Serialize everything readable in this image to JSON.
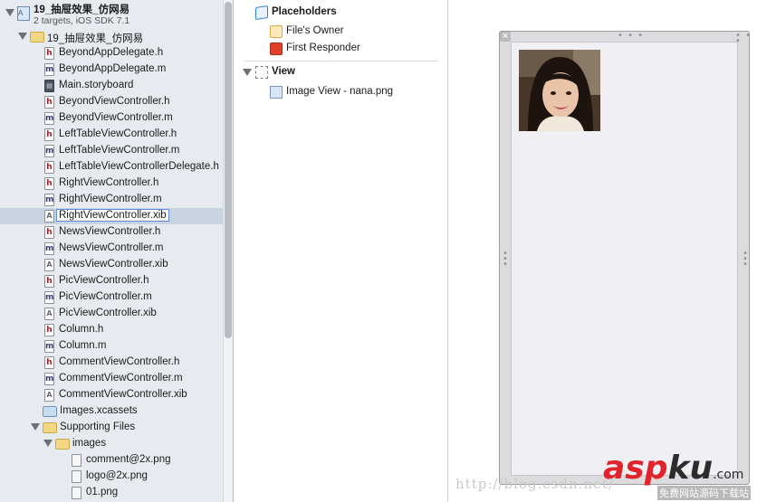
{
  "navigator": {
    "project": {
      "name": "19_抽屉效果_仿网易",
      "subtitle": "2 targets, iOS SDK 7.1"
    },
    "items": [
      {
        "label": "19_抽屉效果_仿网易",
        "type": "folder",
        "indent": 1,
        "disclosure": true,
        "selected": false
      },
      {
        "label": "BeyondAppDelegate.h",
        "type": "h",
        "indent": 2,
        "selected": false
      },
      {
        "label": "BeyondAppDelegate.m",
        "type": "m",
        "indent": 2,
        "selected": false
      },
      {
        "label": "Main.storyboard",
        "type": "sb",
        "indent": 2,
        "selected": false
      },
      {
        "label": "BeyondViewController.h",
        "type": "h",
        "indent": 2,
        "selected": false
      },
      {
        "label": "BeyondViewController.m",
        "type": "m",
        "indent": 2,
        "selected": false
      },
      {
        "label": "LeftTableViewController.h",
        "type": "h",
        "indent": 2,
        "selected": false
      },
      {
        "label": "LeftTableViewController.m",
        "type": "m",
        "indent": 2,
        "selected": false
      },
      {
        "label": "LeftTableViewControllerDelegate.h",
        "type": "h",
        "indent": 2,
        "selected": false
      },
      {
        "label": "RightViewController.h",
        "type": "h",
        "indent": 2,
        "selected": false
      },
      {
        "label": "RightViewController.m",
        "type": "m",
        "indent": 2,
        "selected": false
      },
      {
        "label": "RightViewController.xib",
        "type": "xib",
        "indent": 2,
        "selected": true
      },
      {
        "label": "NewsViewController.h",
        "type": "h",
        "indent": 2,
        "selected": false
      },
      {
        "label": "NewsViewController.m",
        "type": "m",
        "indent": 2,
        "selected": false
      },
      {
        "label": "NewsViewController.xib",
        "type": "xib",
        "indent": 2,
        "selected": false
      },
      {
        "label": "PicViewController.h",
        "type": "h",
        "indent": 2,
        "selected": false
      },
      {
        "label": "PicViewController.m",
        "type": "m",
        "indent": 2,
        "selected": false
      },
      {
        "label": "PicViewController.xib",
        "type": "xib",
        "indent": 2,
        "selected": false
      },
      {
        "label": "Column.h",
        "type": "h",
        "indent": 2,
        "selected": false
      },
      {
        "label": "Column.m",
        "type": "m",
        "indent": 2,
        "selected": false
      },
      {
        "label": "CommentViewController.h",
        "type": "h",
        "indent": 2,
        "selected": false
      },
      {
        "label": "CommentViewController.m",
        "type": "m",
        "indent": 2,
        "selected": false
      },
      {
        "label": "CommentViewController.xib",
        "type": "xib",
        "indent": 2,
        "selected": false
      },
      {
        "label": "Images.xcassets",
        "type": "assets",
        "indent": 2,
        "selected": false
      },
      {
        "label": "Supporting Files",
        "type": "folder",
        "indent": 2,
        "disclosure": true,
        "selected": false
      },
      {
        "label": "images",
        "type": "folder",
        "indent": 3,
        "disclosure": true,
        "selected": false
      },
      {
        "label": "comment@2x.png",
        "type": "png",
        "indent": 4,
        "selected": false
      },
      {
        "label": "logo@2x.png",
        "type": "png",
        "indent": 4,
        "selected": false
      },
      {
        "label": "01.png",
        "type": "png",
        "indent": 4,
        "selected": false
      }
    ]
  },
  "outline": {
    "placeholders_label": "Placeholders",
    "files_owner_label": "File's Owner",
    "first_responder_label": "First Responder",
    "view_label": "View",
    "image_view_label": "Image View - nana.png"
  },
  "canvas": {
    "close_glyph": "×",
    "grip_top": "• • •",
    "grip_side": "•\n•\n•"
  },
  "watermark": {
    "url_text": "http://blog.csdn.net/",
    "logo_asp": "asp",
    "logo_ku": "ku",
    "logo_com": ".com",
    "logo_sub": "免费网站源码下载站"
  },
  "colors": {
    "navigator_bg": "#e7ebf0",
    "selection": "#c9d3e1",
    "logo_red": "#e2232b"
  }
}
